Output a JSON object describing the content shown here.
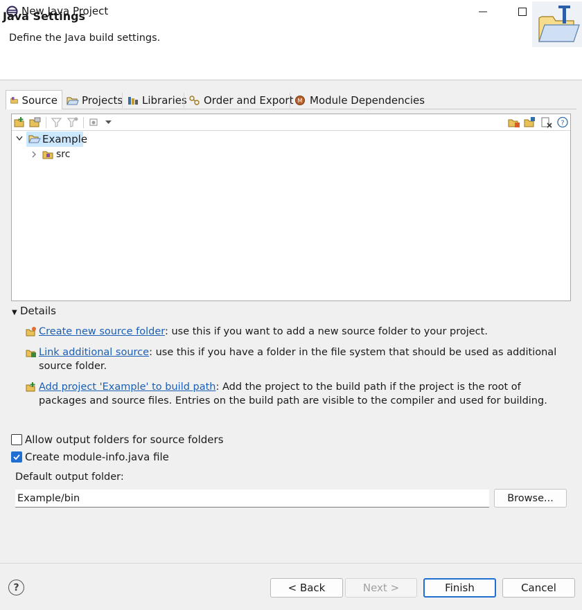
{
  "window": {
    "title": "New Java Project",
    "icon": "eclipse-icon"
  },
  "banner": {
    "title": "Java Settings",
    "description": "Define the Java build settings.",
    "image": "new-project-wizard-icon"
  },
  "tabs": [
    {
      "label": "Source",
      "icon": "source-folder-icon",
      "selected": true
    },
    {
      "label": "Projects",
      "icon": "projects-icon",
      "selected": false
    },
    {
      "label": "Libraries",
      "icon": "libraries-icon",
      "selected": false
    },
    {
      "label": "Order and Export",
      "icon": "order-icon",
      "selected": false
    },
    {
      "label": "Module Dependencies",
      "icon": "module-icon",
      "selected": false
    }
  ],
  "tree": {
    "items": [
      {
        "label": "Example",
        "expanded": true,
        "selected": true
      },
      {
        "label": "src",
        "expanded": false,
        "selected": false
      }
    ]
  },
  "details": {
    "heading": "Details",
    "entries": [
      {
        "link": "Create new source folder",
        "text": ": use this if you want to add a new source folder to your project."
      },
      {
        "link": "Link additional source",
        "text": ": use this if you have a folder in the file system that should be used as additional source folder."
      },
      {
        "link": "Add project 'Example' to build path",
        "text": ": Add the project to the build path if the project is the root of packages and source files. Entries on the build path are visible to the compiler and used for building."
      }
    ]
  },
  "options": {
    "allow_output_folders": {
      "label": "Allow output folders for source folders",
      "checked": false
    },
    "create_module_info": {
      "label": "Create module-info.java file",
      "checked": true
    }
  },
  "output": {
    "label": "Default output folder:",
    "value": "Example/bin",
    "browse_label": "Browse..."
  },
  "buttons": {
    "help": "?",
    "back": "< Back",
    "next": "Next >",
    "finish": "Finish",
    "cancel": "Cancel"
  },
  "colors": {
    "accent": "#1e6fd0",
    "link": "#1a5fb4",
    "selection": "#cce8ff"
  }
}
